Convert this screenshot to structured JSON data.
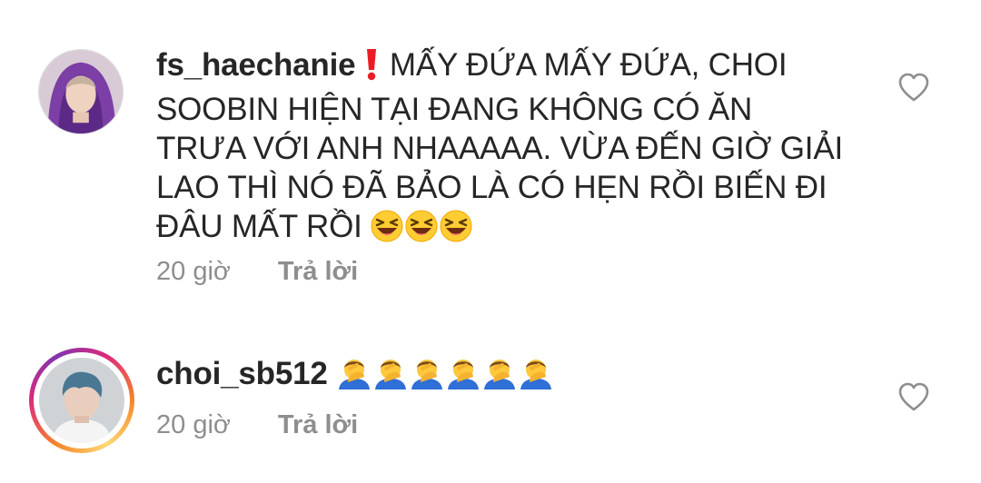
{
  "comments": [
    {
      "username": "fs_haechanie",
      "text_before_emoji": "MẤY ĐỨA MẤY ĐỨA, CHOI SOOBIN HIỆN TẠI ĐANG KHÔNG CÓ ĂN TRƯA VỚI ANH NHAAAAA. VỪA ĐẾN GIỜ GIẢI LAO THÌ NÓ ĐÃ BẢO LÀ CÓ HẸN RỒI BIẾN ĐI ĐÂU MẤT RỒI",
      "leading_icon": "red-exclamation-icon",
      "trailing_emoji": [
        "laughing-squint-emoji",
        "laughing-squint-emoji",
        "laughing-squint-emoji"
      ],
      "time": "20 giờ",
      "reply_label": "Trả lời",
      "has_story_ring": false
    },
    {
      "username": "choi_sb512",
      "trailing_emoji": [
        "facepalm-emoji",
        "facepalm-emoji",
        "facepalm-emoji",
        "facepalm-emoji",
        "facepalm-emoji",
        "facepalm-emoji"
      ],
      "time": "20 giờ",
      "reply_label": "Trả lời",
      "has_story_ring": true
    }
  ],
  "colors": {
    "text": "#262626",
    "muted": "#8e8e8e",
    "exclamation": "#ed1c24",
    "story_ring": [
      "#f58529",
      "#dd2a7b",
      "#8134af",
      "#feda77"
    ]
  }
}
